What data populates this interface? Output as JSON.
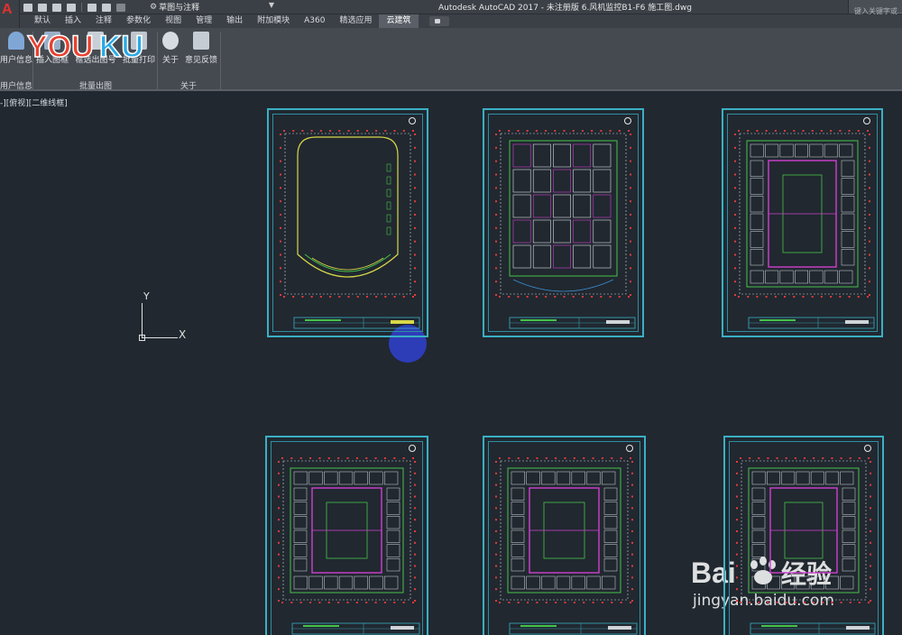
{
  "titlebar": {
    "workspace": "草图与注释",
    "window_title": "Autodesk AutoCAD 2017 - 未注册版    6.风机监控B1-F6 施工图.dwg",
    "search_placeholder": "键入关键字或..."
  },
  "tabs": [
    {
      "label": "默认"
    },
    {
      "label": "插入"
    },
    {
      "label": "注释"
    },
    {
      "label": "参数化"
    },
    {
      "label": "视图"
    },
    {
      "label": "管理"
    },
    {
      "label": "输出"
    },
    {
      "label": "附加模块"
    },
    {
      "label": "A360"
    },
    {
      "label": "精选应用"
    },
    {
      "label": "云建筑",
      "active": true
    }
  ],
  "ribbon": {
    "buttons": [
      {
        "label": "用户信息",
        "icon": "user-icon"
      },
      {
        "label": "插入图框",
        "icon": "frame-icon"
      },
      {
        "label": "框选出图号",
        "icon": "number-icon"
      },
      {
        "label": "批量打印",
        "icon": "print-icon"
      },
      {
        "label": "关于",
        "icon": "info-icon"
      },
      {
        "label": "意见反馈",
        "icon": "feedback-icon"
      }
    ],
    "panels": [
      {
        "title": "用户信息"
      },
      {
        "title": "批量出图"
      },
      {
        "title": "关于"
      }
    ]
  },
  "watermark_youku": "YOUKU",
  "viewport_label": "-][俯视][二维线框]",
  "ucs": {
    "y_label": "Y",
    "x_label": "X"
  },
  "baidu": {
    "brand": "Bai du 经验",
    "url": "jingyan.baidu.com"
  },
  "colors": {
    "canvas": "#212830",
    "sheet_border": "#3ab0c4",
    "drawing_green": "#46c24a",
    "drawing_magenta": "#d040d0",
    "drawing_yellow": "#d8d84a",
    "axis_red": "#e23a3a",
    "cursor_blue": "#2f3fc8",
    "accent_red": "#e2312d"
  }
}
